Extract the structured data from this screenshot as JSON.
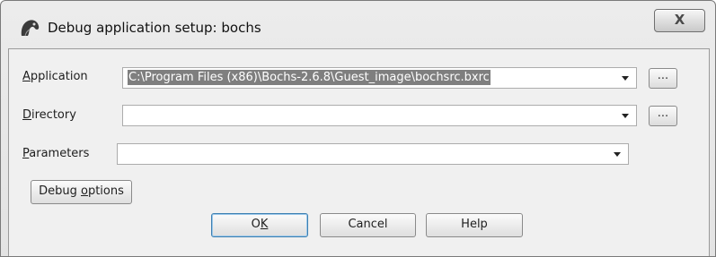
{
  "window": {
    "title": "Debug application setup: bochs",
    "close_label": "X"
  },
  "form": {
    "application": {
      "label_mnemonic": "A",
      "label_rest": "pplication",
      "value": "C:\\Program Files (x86)\\Bochs-2.6.8\\Guest_image\\bochsrc.bxrc",
      "browse_label": "..."
    },
    "directory": {
      "label_mnemonic": "D",
      "label_rest": "irectory",
      "value": "",
      "browse_label": "..."
    },
    "parameters": {
      "label_mnemonic": "P",
      "label_rest": "arameters",
      "value": ""
    }
  },
  "buttons": {
    "debug_options": {
      "label_pre": "Debug ",
      "label_mnemonic": "o",
      "label_post": "ptions"
    },
    "ok": {
      "label_pre": "O",
      "label_mnemonic": "K"
    },
    "cancel": {
      "label": "Cancel"
    },
    "help": {
      "label": "Help"
    }
  }
}
